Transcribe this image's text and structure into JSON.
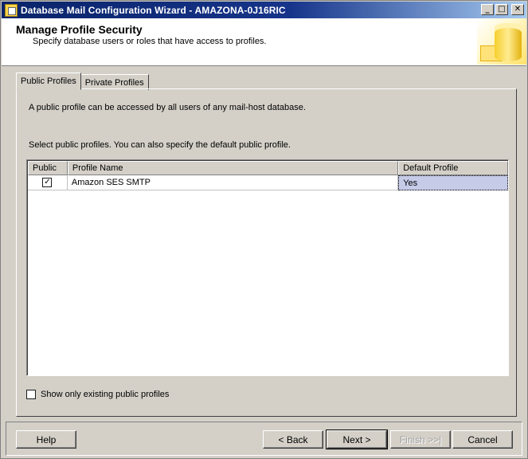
{
  "window": {
    "title": "Database Mail Configuration Wizard - AMAZONA-0J16RIC",
    "minimize_glyph": "_",
    "maximize_glyph": "□",
    "close_glyph": "✕"
  },
  "header": {
    "title": "Manage Profile Security",
    "subtitle": "Specify database users or roles that have access to profiles."
  },
  "tabs": [
    {
      "label": "Public Profiles",
      "active": true
    },
    {
      "label": "Private Profiles",
      "active": false
    }
  ],
  "panel": {
    "description": "A public profile can be accessed by all users of any mail-host database.",
    "instruction": "Select public profiles. You can also specify the default public profile."
  },
  "grid": {
    "columns": [
      "Public",
      "Profile Name",
      "Default Profile"
    ],
    "rows": [
      {
        "public": true,
        "profile_name": "Amazon SES SMTP",
        "default_profile": "Yes"
      }
    ],
    "check_glyph": "✓"
  },
  "options": {
    "show_only_existing_label": "Show only existing public profiles",
    "show_only_existing_checked": false
  },
  "buttons": {
    "help": "Help",
    "back": "< Back",
    "next": "Next >",
    "finish": "Finish >>|",
    "cancel": "Cancel"
  }
}
